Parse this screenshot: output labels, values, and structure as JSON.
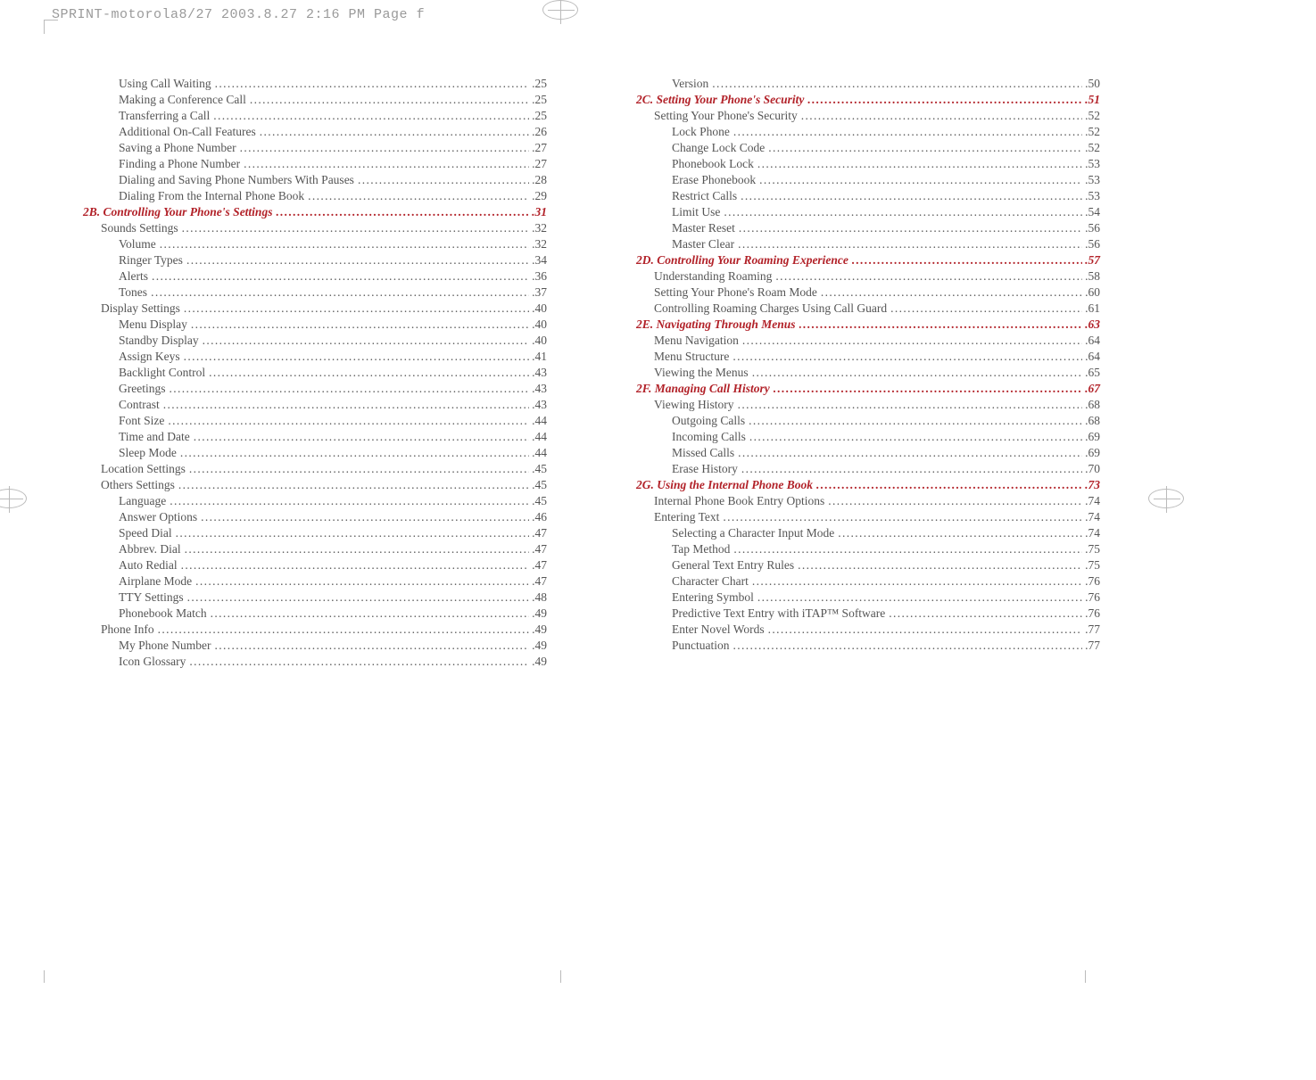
{
  "meta_line": "SPRINT-motorola8/27  2003.8.27  2:16 PM  Page f",
  "columns": [
    [
      {
        "level": 3,
        "title": "Using Call Waiting",
        "page": ".25"
      },
      {
        "level": 3,
        "title": "Making a Conference Call",
        "page": ".25"
      },
      {
        "level": 3,
        "title": "Transferring a Call",
        "page": ".25"
      },
      {
        "level": 3,
        "title": "Additional On-Call Features",
        "page": ".26"
      },
      {
        "level": 3,
        "title": "Saving a Phone Number",
        "page": ".27"
      },
      {
        "level": 3,
        "title": "Finding a Phone Number",
        "page": ".27"
      },
      {
        "level": 3,
        "title": "Dialing and Saving Phone Numbers With Pauses",
        "page": ".28"
      },
      {
        "level": 3,
        "title": "Dialing From the Internal Phone Book",
        "page": ".29"
      },
      {
        "level": 1,
        "section": true,
        "title": "2B. Controlling Your Phone's Settings",
        "page": ".31"
      },
      {
        "level": 2,
        "title": "Sounds Settings",
        "page": ".32"
      },
      {
        "level": 3,
        "title": "Volume",
        "page": ".32"
      },
      {
        "level": 3,
        "title": "Ringer Types",
        "page": ".34"
      },
      {
        "level": 3,
        "title": "Alerts",
        "page": ".36"
      },
      {
        "level": 3,
        "title": "Tones",
        "page": ".37"
      },
      {
        "level": 2,
        "title": "Display Settings",
        "page": ".40"
      },
      {
        "level": 3,
        "title": "Menu Display",
        "page": ".40"
      },
      {
        "level": 3,
        "title": "Standby Display",
        "page": ".40"
      },
      {
        "level": 3,
        "title": "Assign Keys",
        "page": ".41"
      },
      {
        "level": 3,
        "title": "Backlight Control",
        "page": ".43"
      },
      {
        "level": 3,
        "title": "Greetings",
        "page": ".43"
      },
      {
        "level": 3,
        "title": "Contrast",
        "page": ".43"
      },
      {
        "level": 3,
        "title": "Font Size",
        "page": ".44"
      },
      {
        "level": 3,
        "title": "Time and Date",
        "page": ".44"
      },
      {
        "level": 3,
        "title": "Sleep Mode",
        "page": ".44"
      },
      {
        "level": 2,
        "title": "Location Settings",
        "page": ".45"
      },
      {
        "level": 2,
        "title": "Others Settings",
        "page": ".45"
      },
      {
        "level": 3,
        "title": "Language",
        "page": ".45"
      },
      {
        "level": 3,
        "title": "Answer Options",
        "page": ".46"
      },
      {
        "level": 3,
        "title": "Speed Dial",
        "page": ".47"
      },
      {
        "level": 3,
        "title": "Abbrev. Dial",
        "page": ".47"
      },
      {
        "level": 3,
        "title": "Auto Redial",
        "page": ".47"
      },
      {
        "level": 3,
        "title": "Airplane Mode",
        "page": ".47"
      },
      {
        "level": 3,
        "title": "TTY Settings",
        "page": ".48"
      },
      {
        "level": 3,
        "title": "Phonebook Match",
        "page": ".49"
      },
      {
        "level": 2,
        "title": "Phone Info",
        "page": ".49"
      },
      {
        "level": 3,
        "title": "My Phone Number",
        "page": ".49"
      },
      {
        "level": 3,
        "title": "Icon Glossary",
        "page": ".49"
      }
    ],
    [
      {
        "level": 3,
        "title": "Version",
        "page": ".50"
      },
      {
        "level": 1,
        "section": true,
        "title": "2C. Setting Your Phone's Security",
        "page": ".51"
      },
      {
        "level": 2,
        "title": "Setting Your Phone's Security",
        "page": ".52"
      },
      {
        "level": 3,
        "title": "Lock Phone",
        "page": ".52"
      },
      {
        "level": 3,
        "title": "Change Lock Code",
        "page": ".52"
      },
      {
        "level": 3,
        "title": "Phonebook Lock",
        "page": ".53"
      },
      {
        "level": 3,
        "title": "Erase Phonebook",
        "page": ".53"
      },
      {
        "level": 3,
        "title": "Restrict Calls",
        "page": ".53"
      },
      {
        "level": 3,
        "title": "Limit Use",
        "page": ".54"
      },
      {
        "level": 3,
        "title": "Master Reset",
        "page": ".56"
      },
      {
        "level": 3,
        "title": "Master Clear",
        "page": ".56"
      },
      {
        "level": 1,
        "section": true,
        "title": "2D. Controlling Your Roaming Experience",
        "page": ".57"
      },
      {
        "level": 2,
        "title": "Understanding Roaming",
        "page": ".58"
      },
      {
        "level": 2,
        "title": "Setting Your Phone's Roam Mode",
        "page": ".60"
      },
      {
        "level": 2,
        "title": "Controlling Roaming Charges Using Call Guard",
        "page": ".61"
      },
      {
        "level": 1,
        "section": true,
        "title": "2E. Navigating Through Menus",
        "page": ".63"
      },
      {
        "level": 2,
        "title": "Menu Navigation",
        "page": ".64"
      },
      {
        "level": 2,
        "title": "Menu Structure",
        "page": ".64"
      },
      {
        "level": 2,
        "title": "Viewing the Menus",
        "page": ".65"
      },
      {
        "level": 1,
        "section": true,
        "title": "2F.  Managing Call History",
        "page": ".67"
      },
      {
        "level": 2,
        "title": "Viewing History",
        "page": ".68"
      },
      {
        "level": 3,
        "title": "Outgoing Calls",
        "page": ".68"
      },
      {
        "level": 3,
        "title": "Incoming Calls",
        "page": ".69"
      },
      {
        "level": 3,
        "title": "Missed Calls",
        "page": ".69"
      },
      {
        "level": 3,
        "title": "Erase History",
        "page": ".70"
      },
      {
        "level": 1,
        "section": true,
        "title": "2G. Using the Internal Phone Book",
        "page": ".73"
      },
      {
        "level": 2,
        "title": "Internal Phone Book Entry Options",
        "page": ".74"
      },
      {
        "level": 2,
        "title": "Entering Text",
        "page": ".74"
      },
      {
        "level": 3,
        "title": "Selecting a Character Input Mode",
        "page": ".74"
      },
      {
        "level": 3,
        "title": "Tap Method",
        "page": ".75"
      },
      {
        "level": 3,
        "title": "General Text Entry Rules",
        "page": ".75"
      },
      {
        "level": 3,
        "title": "Character Chart",
        "page": ".76"
      },
      {
        "level": 3,
        "title": "Entering Symbol",
        "page": ".76"
      },
      {
        "level": 3,
        "title": "Predictive Text Entry with iTAP™ Software",
        "page": ".76"
      },
      {
        "level": 3,
        "title": "Enter Novel Words",
        "page": ".77"
      },
      {
        "level": 3,
        "title": "Punctuation",
        "page": ".77"
      }
    ]
  ]
}
